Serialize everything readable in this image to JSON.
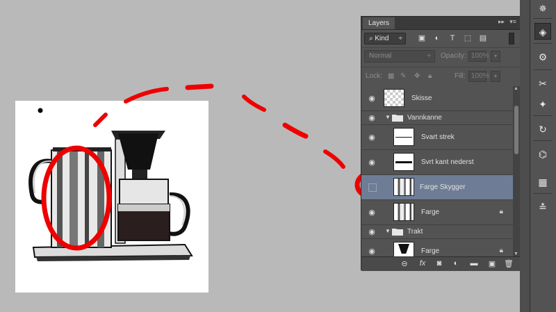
{
  "panel": {
    "tab_label": "Layers",
    "kind_label": "Kind",
    "blend_mode": "Normal",
    "opacity_label": "Opacity:",
    "opacity_value": "100%",
    "lock_label": "Lock:",
    "fill_label": "Fill:",
    "fill_value": "100%"
  },
  "layers": [
    {
      "name": "Skisse",
      "type": "layer",
      "visible": true,
      "thumb": "transparent"
    },
    {
      "name": "Vannkanne",
      "type": "group",
      "visible": true,
      "expanded": true
    },
    {
      "name": "Svart strek",
      "type": "layer",
      "visible": true,
      "thumb": "line"
    },
    {
      "name": "Svrt kant nederst",
      "type": "layer",
      "visible": true,
      "thumb": "line"
    },
    {
      "name": "Farge Skygger",
      "type": "layer",
      "visible": false,
      "selected": true,
      "thumb": "kettle"
    },
    {
      "name": "Farge",
      "type": "layer",
      "visible": true,
      "locked": true,
      "thumb": "kettle"
    },
    {
      "name": "Trakt",
      "type": "group",
      "visible": true,
      "expanded": true
    },
    {
      "name": "Farge",
      "type": "layer",
      "visible": true,
      "locked": true,
      "thumb": "funnel"
    }
  ],
  "icons": {
    "search": "search-icon",
    "eye": "eye-icon",
    "lock": "lock-icon",
    "folder": "folder-icon"
  },
  "annotations": {
    "highlight_color": "#ee0000"
  },
  "colors": {
    "selected_row": "#6e7d95",
    "panel_bg": "#535353",
    "canvas_bg": "#b9b9b9"
  }
}
